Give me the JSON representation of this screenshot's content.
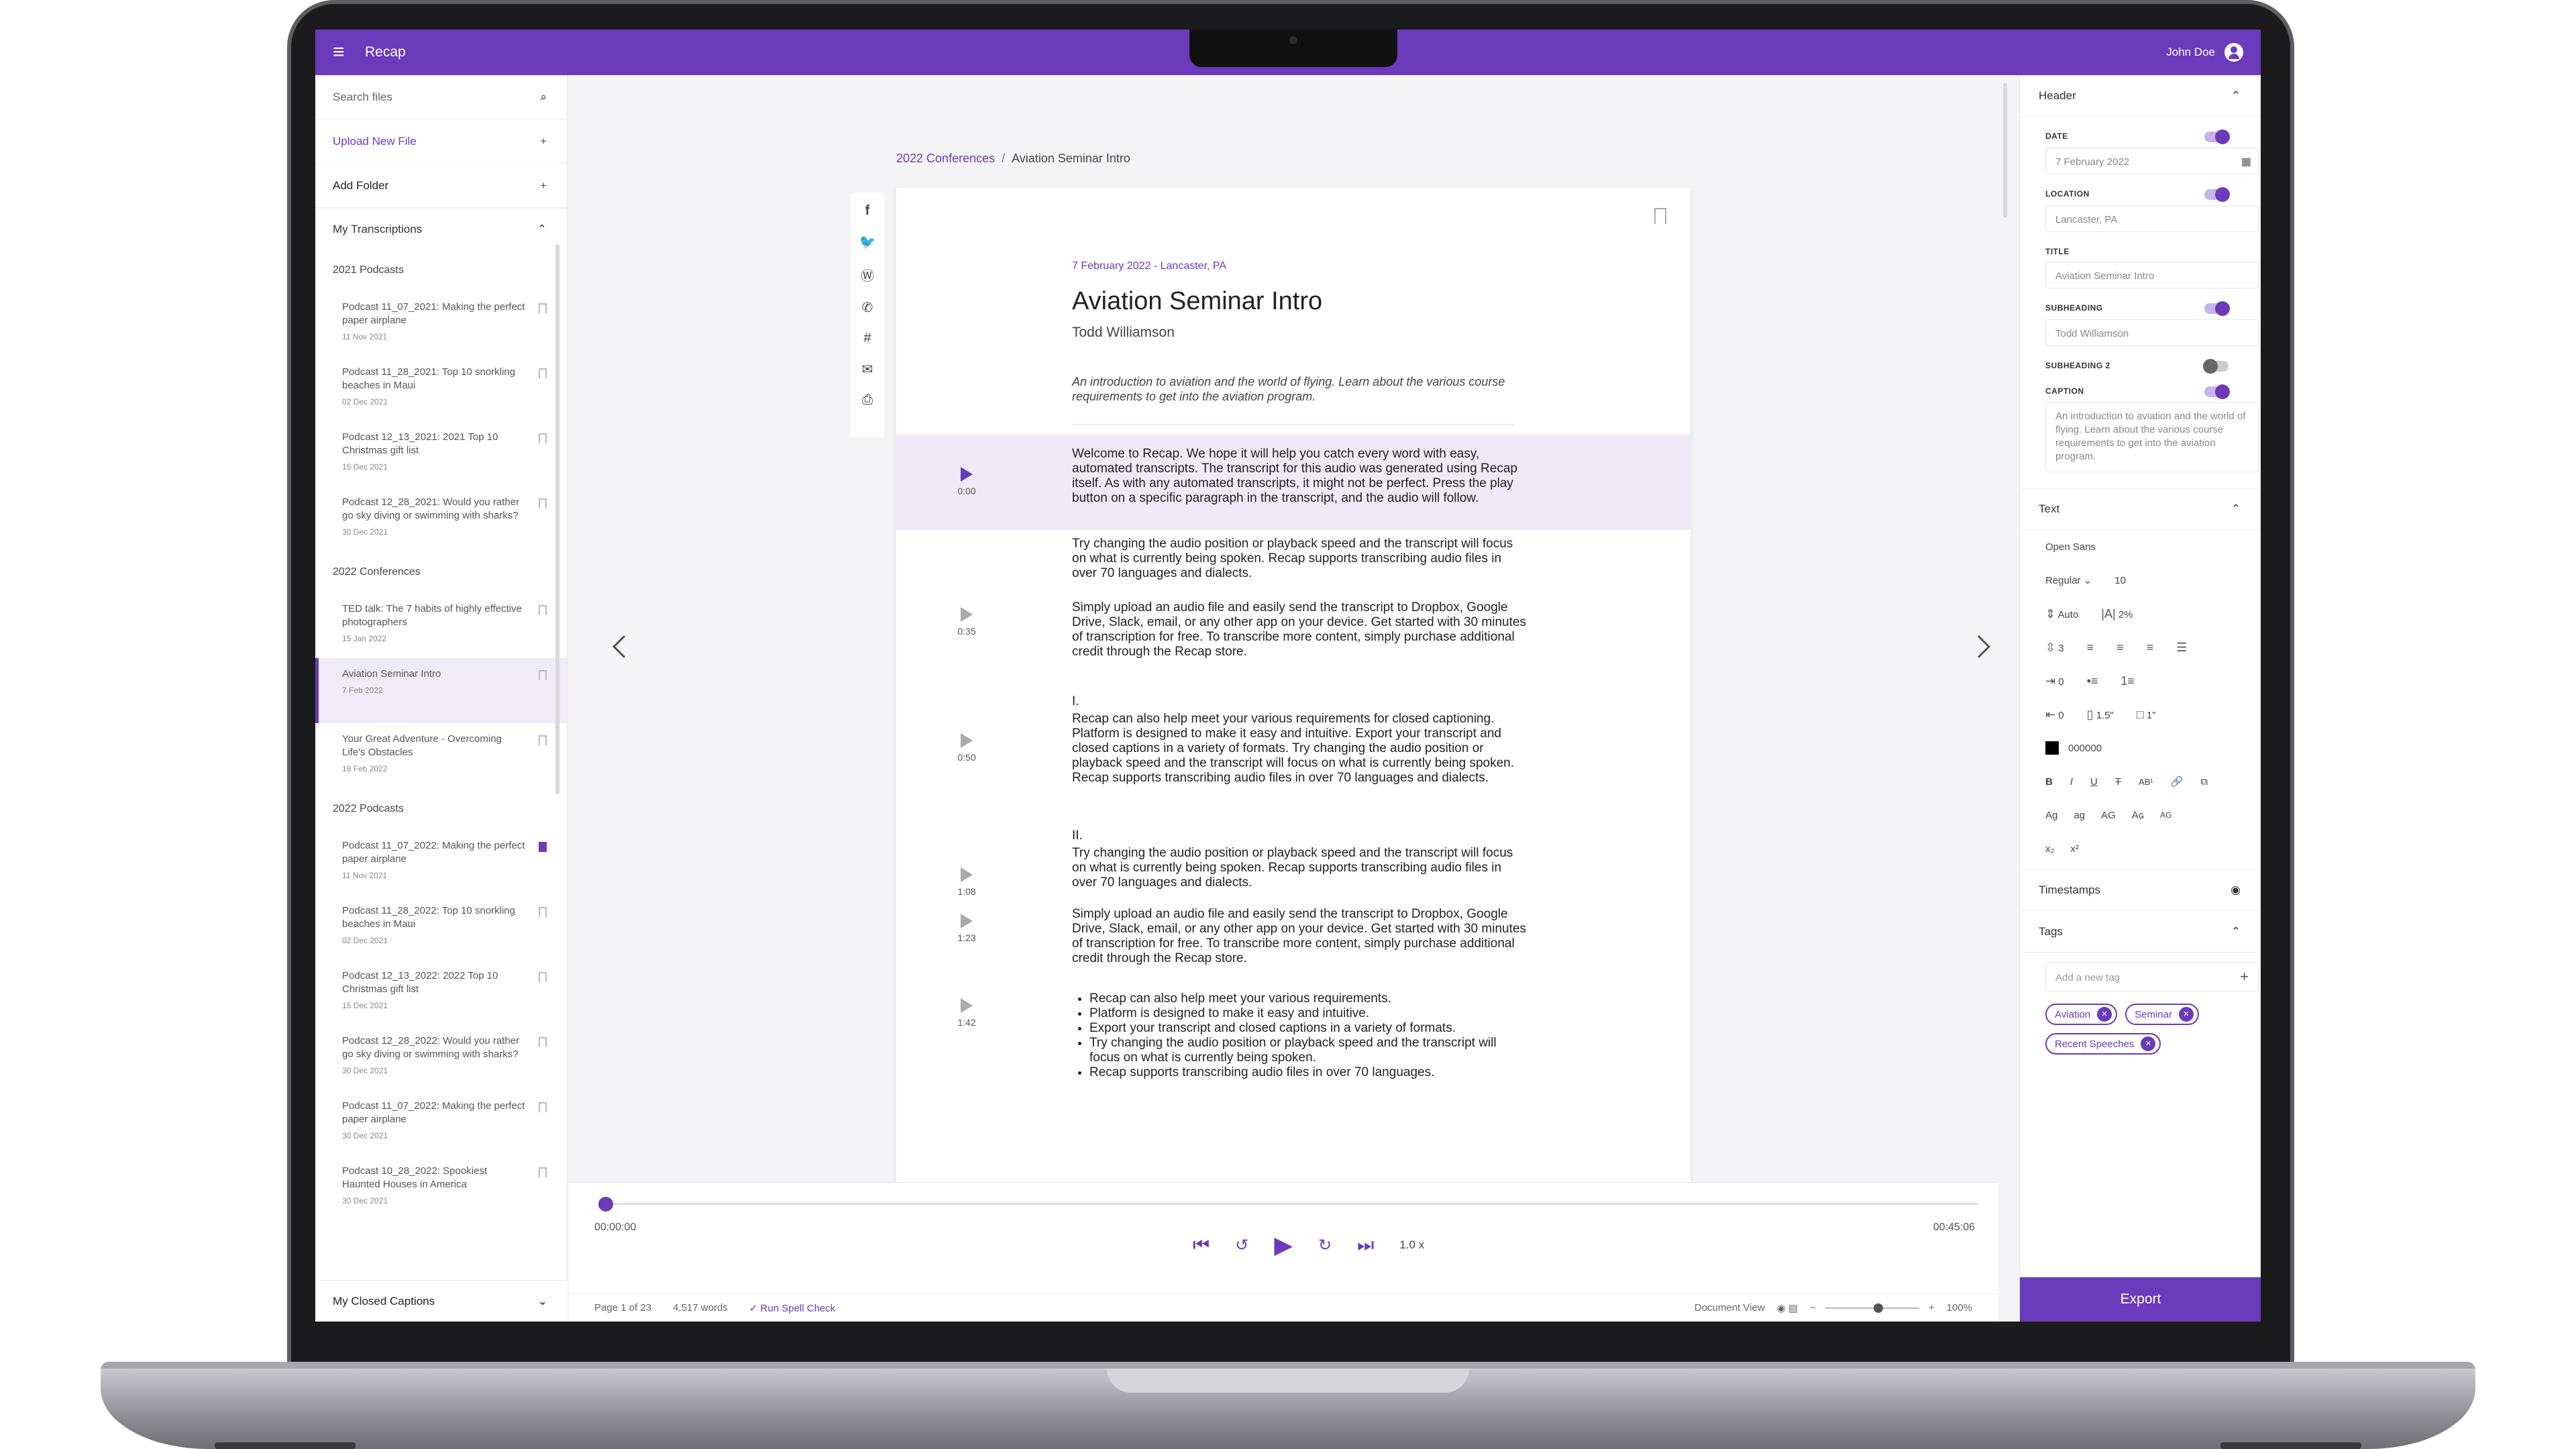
{
  "app": {
    "title": "Recap",
    "user": "John Doe"
  },
  "sidebar": {
    "search_placeholder": "Search files",
    "upload_label": "Upload New File",
    "add_folder_label": "Add Folder",
    "section_title": "My Transcriptions",
    "footer_title": "My Closed Captions",
    "groups": [
      {
        "name": "2021 Podcasts",
        "items": [
          {
            "title": "Podcast 11_07_2021: Making the perfect paper airplane",
            "date": "11 Nov 2021"
          },
          {
            "title": "Podcast 11_28_2021: Top 10 snorkling beaches in Maui",
            "date": "02 Dec 2021"
          },
          {
            "title": "Podcast 12_13_2021: 2021 Top 10 Christmas gift list",
            "date": "15 Dec 2021"
          },
          {
            "title": "Podcast 12_28_2021: Would you rather go sky diving or swimming with sharks?",
            "date": "30 Dec 2021"
          }
        ]
      },
      {
        "name": "2022 Conferences",
        "items": [
          {
            "title": "TED talk: The 7 habits of highly effective photographers",
            "date": "15 Jan 2022"
          },
          {
            "title": "Aviation Seminar Intro",
            "date": "7 Feb 2022"
          },
          {
            "title": "Your Great Adventure - Overcoming Life's Obstacles",
            "date": "18 Feb 2022"
          }
        ]
      },
      {
        "name": "2022 Podcasts",
        "items": [
          {
            "title": "Podcast 11_07_2022: Making the perfect paper airplane",
            "date": "11 Nov 2021"
          },
          {
            "title": "Podcast 11_28_2022: Top 10 snorkling beaches in Maui",
            "date": "02 Dec 2021"
          },
          {
            "title": "Podcast 12_13_2022: 2022 Top 10 Christmas gift list",
            "date": "15 Dec 2021"
          },
          {
            "title": "Podcast 12_28_2022: Would you rather go sky diving or swimming with sharks?",
            "date": "30 Dec 2021"
          },
          {
            "title": "Podcast 11_07_2022: Making the perfect paper airplane",
            "date": "30 Dec 2021"
          },
          {
            "title": "Podcast 10_28_2022: Spookiest Haunted Houses in America",
            "date": "30 Dec 2021"
          }
        ]
      }
    ]
  },
  "breadcrumb": {
    "parent": "2022 Conferences",
    "current": "Aviation Seminar Intro"
  },
  "document": {
    "meta": "7 February 2022 - Lancaster, PA",
    "title": "Aviation Seminar Intro",
    "subheading": "Todd Williamson",
    "caption": "An introduction to aviation and the world of flying. Learn about the various course requirements to get into the aviation program.",
    "paragraphs": [
      {
        "ts": "0:00",
        "text": "Welcome to Recap. We hope it will help you catch every word with easy, automated transcripts. The transcript for this audio was generated using Recap itself. As with any automated transcripts, it might not be perfect. Press the play button on a specific paragraph in the transcript, and the audio will follow."
      },
      {
        "ts": "",
        "text": "Try changing the audio position or playback speed and the transcript will focus on what is currently being spoken. Recap supports transcribing audio files in over 70 languages and dialects."
      },
      {
        "ts": "0:35",
        "text": "Simply upload an audio file and easily send the transcript to Dropbox, Google Drive, Slack, email, or any other app on your device. Get started with 30 minutes of transcription for free. To transcribe more content, simply purchase additional credit through the Recap store."
      },
      {
        "ts": "0:50",
        "heading": "I.",
        "text": "Recap can also help meet your various requirements for closed captioning. Platform is designed to make it easy and intuitive. Export your transcript and closed captions in a variety of formats. Try changing the audio position or playback speed and the transcript will focus on what is currently being spoken. Recap supports transcribing audio files in over 70 languages and dialects."
      },
      {
        "ts": "1:08",
        "heading": "II.",
        "text": "Try changing the audio position or playback speed and the transcript will focus on what is currently being spoken. Recap supports transcribing audio files in over 70 languages and dialects."
      },
      {
        "ts": "1:23",
        "text": "Simply upload an audio file and easily send the transcript to Dropbox, Google Drive, Slack, email, or any other app on your device. Get started with 30 minutes of transcription for free. To transcribe more content, simply purchase additional credit through the Recap store."
      },
      {
        "ts": "1:42",
        "bullets": [
          "Recap can also help meet your various requirements.",
          "Platform is designed to make it easy and intuitive.",
          "Export your transcript and closed captions in a variety of formats.",
          "Try changing the audio position or playback speed and the transcript will focus on what is currently being spoken.",
          "Recap supports transcribing audio files in over 70 languages."
        ]
      }
    ]
  },
  "player": {
    "start": "00:00:00",
    "end": "00:45:06",
    "speed": "1.0 x",
    "progress": 0.0
  },
  "status": {
    "page": "Page 1 of 23",
    "words": "4,517 words",
    "spell": "Run Spell Check",
    "view": "Document View",
    "zoom": "100%"
  },
  "panel": {
    "header_title": "Header",
    "date_label": "DATE",
    "date_value": "7 February 2022",
    "location_label": "LOCATION",
    "location_value": "Lancaster, PA",
    "title_label": "TITLE",
    "title_value": "Aviation Seminar Intro",
    "subheading_label": "SUBHEADING",
    "subheading_value": "Todd Williamson",
    "subheading2_label": "SUBHEADING 2",
    "caption_label": "CAPTION",
    "caption_value": "An introduction to aviation and the world of flying. Learn about the various course requirements to get into the aviation program.",
    "text_title": "Text",
    "font": "Open Sans",
    "weight": "Regular",
    "size": "10",
    "line_height": "Auto",
    "letter_spacing": "2%",
    "spacing_1": "3",
    "spacing_2": "0",
    "spacing_3": "0",
    "margin_a": "1.5\"",
    "margin_b": "1\"",
    "color": "000000",
    "timestamps_title": "Timestamps",
    "tags_title": "Tags",
    "tag_placeholder": "Add a new tag",
    "tags": [
      "Aviation",
      "Seminar",
      "Recent Speeches"
    ],
    "export_label": "Export"
  },
  "colors": {
    "accent": "#6b3bbb",
    "highlight": "#efe9f8"
  }
}
